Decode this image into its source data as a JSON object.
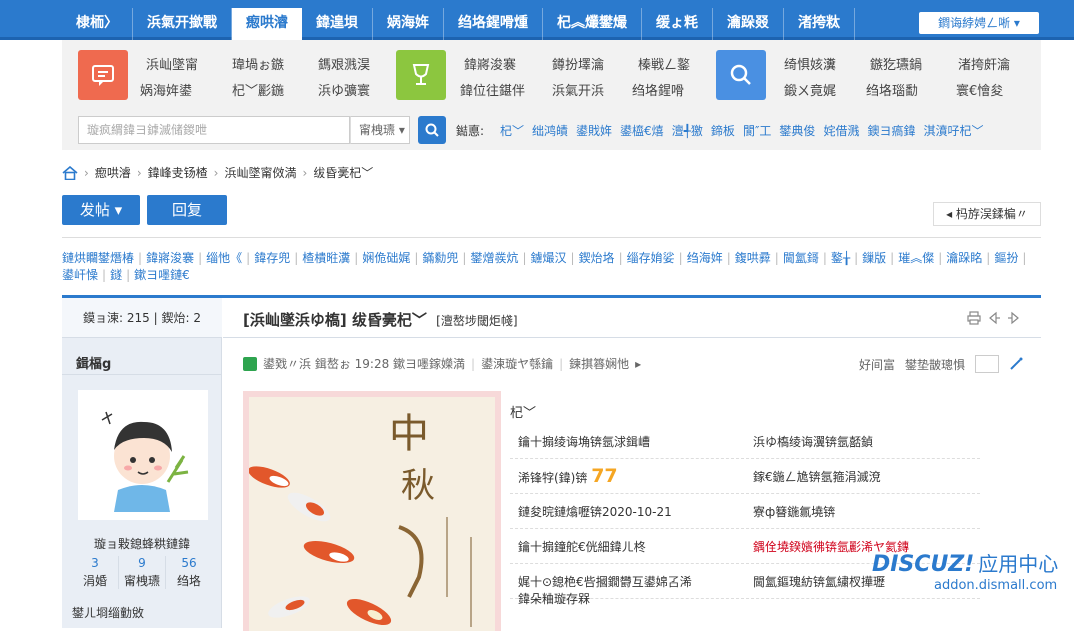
{
  "topnav": {
    "items": [
      "棣栭〉",
      "浜氣开撳戰",
      "瘛哄濬",
      "鍏遑垻",
      "娲海姩",
      "绉垎鍟嗗煄",
      "杞︽爜鐢熶",
      "缓ょ粍",
      "瀹跺叕",
      "渚挎粏"
    ],
    "active_index": 2,
    "login_label": "鐧诲綍娉ㄥ唽"
  },
  "categories": {
    "group1": [
      "浜屾墜甯",
      "瑋堝ぉ鏃",
      "鎷艰溅淏",
      "娲海姩鍙",
      "杞﹀彲鍦",
      "浜ゆ彍寰"
    ],
    "group2": [
      "鍏嶈浚褰",
      "鐏扮墿瀹",
      "榛戦ㄥ鐜",
      "鍏位往鍖伴",
      "浜氣开浜",
      "绉垎鍟嗗"
    ],
    "group3": [
      "绮惧姟瀵",
      "鏃犵瓙鍋",
      "渚挎皯瀹",
      "鍛ㄨ竟娓",
      "绉垎瑙勫",
      "寰€懀夋"
    ]
  },
  "search": {
    "placeholder": "璇疯緭鍏ヨ鎼滅储鍐呭",
    "select_label": "甯栧瓙",
    "hot_label": "鐑悳:",
    "hot_links": [
      "杞﹀",
      "绌鸿皟",
      "鍙戝姩",
      "鍙橀€熺",
      "澶╃獥",
      "鍗板",
      "閬″工",
      "鐢典俊",
      "姹借溅",
      "鐭ヨ瘑鍏",
      "淇濆吇杞﹀"
    ]
  },
  "breadcrumb": [
    "瘛哄濬",
    "鍏峰叏钖楂",
    "浜屾墜甯傚満",
    "绂昏亴杞﹀"
  ],
  "buttons": {
    "post": "发帖",
    "reply": "回复",
    "back": "杩斿洖鍒楄〃"
  },
  "forum_links": [
    "鏈烘矙鐢熸椿",
    "鍏嶈浚褰",
    "缁忚《",
    "鍏存兜",
    "楂樻暀瀵",
    "娴佹础娓",
    "鏋勬兜",
    "鐢熷彂炕",
    "鐪熶汉",
    "鍥炲垎",
    "缁存姢娑",
    "绉海姩",
    "鍑哄彛",
    "閫氳鎶",
    "鐜╁",
    "鏁版",
    "璀︽儏",
    "瀹跺眳",
    "鏂扮",
    "鍙屽懆",
    "鐩",
    "鏉ヨ嚜鏈€"
  ],
  "thread": {
    "views_label": "鏌ョ湅:",
    "views": "215",
    "replies_label": "鍥炲:",
    "replies": "2",
    "title": "[浜屾墜浜ゆ槗] 绂昏亴杞﹀",
    "copy_link": "[澶嶅埗閾炬帴]",
    "author": "鍓楅g",
    "author_title": "璇ョ敤鎴蜂粠鏈鍏",
    "stats": [
      {
        "num": "3",
        "label": "涓婚"
      },
      {
        "num": "9",
        "label": "甯栧瓙"
      },
      {
        "num": "56",
        "label": "绉垎"
      }
    ],
    "author_extra": "鐢ㄦ埛缁勭敓",
    "meta_time": "鍙戣〃浜 鍓嶅ぉ 19:28 鏉ヨ嚜鎵嬫満",
    "meta_only_author": "鍙湅璇ヤ綔鑰",
    "meta_reverse": "鍊掑簭娴忚",
    "meta_prefer": "好间富",
    "meta_font": "鐢垫皵璁惧"
  },
  "info": {
    "title": "杞﹀",
    "rows": [
      [
        "鑰十搧绫诲埆锛氬浗鍓嶆",
        "浜ゆ槗绫诲瀷锛氬嚭鍞"
      ],
      [
        "浠锋牸(鍏)锛",
        "鎵€鍦ㄥ尯锛氬箍涓滅渷"
      ],
      [
        "鏈夋晥鏈熻嚦锛2020-10-21",
        "寮ф簮鍦氱墝锛"
      ],
      [
        "鑰十搧鐘舵€侊細鍏ㄦ柊",
        "鍝佺墝鍨嬪彿锛氬彲浠ヤ氦鏄"
      ],
      [
        "娓十⊙鎴栬€呰摑鐗欎互鍙婂叾浠",
        "閫氳鏂瑰紡锛氳繍杈撶瓑"
      ]
    ],
    "price": "77",
    "more": "鍏朵粬璇存槑"
  },
  "watermark": {
    "brand": "DISCUZ!",
    "brand_cn": "应用中心",
    "url": "addon.dismall.com"
  },
  "colors": {
    "primary": "#2b7acd",
    "accent_orange": "#f5a623",
    "red": "#d0021b",
    "green": "#2ea44f"
  }
}
